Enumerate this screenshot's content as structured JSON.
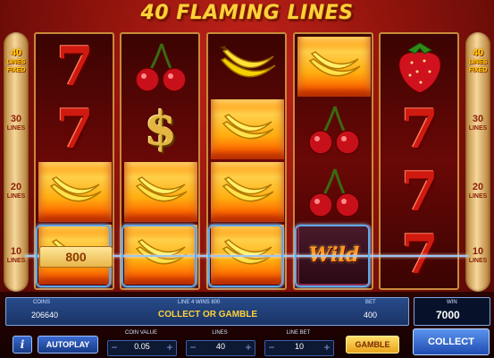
{
  "game": {
    "title": "40 FLAMING LINES"
  },
  "lines_left": [
    {
      "num": "40",
      "lines": "LINES",
      "extra": "FIXED",
      "active": true
    },
    {
      "num": "30",
      "lines": "LINES",
      "extra": "",
      "active": false
    },
    {
      "num": "20",
      "lines": "LINES",
      "extra": "",
      "active": false
    },
    {
      "num": "10",
      "lines": "LINES",
      "extra": "",
      "active": false
    }
  ],
  "lines_right": [
    {
      "num": "40",
      "lines": "LINES",
      "extra": "FIXED",
      "active": true
    },
    {
      "num": "30",
      "lines": "LINES",
      "extra": "",
      "active": false
    },
    {
      "num": "20",
      "lines": "LINES",
      "extra": "",
      "active": false
    },
    {
      "num": "10",
      "lines": "LINES",
      "extra": "",
      "active": false
    }
  ],
  "reels": [
    [
      "seven",
      "seven",
      "banana-fire",
      "banana-fire"
    ],
    [
      "cherry",
      "dollar",
      "banana-fire",
      "banana-fire"
    ],
    [
      "banana",
      "banana-fire",
      "banana-fire",
      "banana-fire"
    ],
    [
      "banana-fire",
      "cherry",
      "cherry",
      "wild"
    ],
    [
      "strawberry",
      "seven",
      "seven",
      "seven"
    ]
  ],
  "symbols": {
    "wild_label": "Wild"
  },
  "win_value": "800",
  "info": {
    "coins_label": "COINS",
    "coins_value": "206640",
    "line_win_text": "LINE 4 WINS 800",
    "message": "COLLECT OR GAMBLE",
    "bet_label": "BET",
    "bet_value": "400",
    "win_label": "WIN",
    "win_value": "7000"
  },
  "controls": {
    "info_label": "i",
    "autoplay_label": "AUTOPLAY",
    "coin_value_label": "COIN VALUE",
    "coin_value": "0.05",
    "lines_label": "LINES",
    "lines_value": "40",
    "line_bet_label": "LINE BET",
    "line_bet_value": "10",
    "gamble_label": "GAMBLE",
    "collect_label": "COLLECT",
    "minus": "−",
    "plus": "+"
  },
  "colors": {
    "accent": "#ffd23a",
    "panel_blue": "#1b3467",
    "win_line": "#9ec6f0"
  }
}
